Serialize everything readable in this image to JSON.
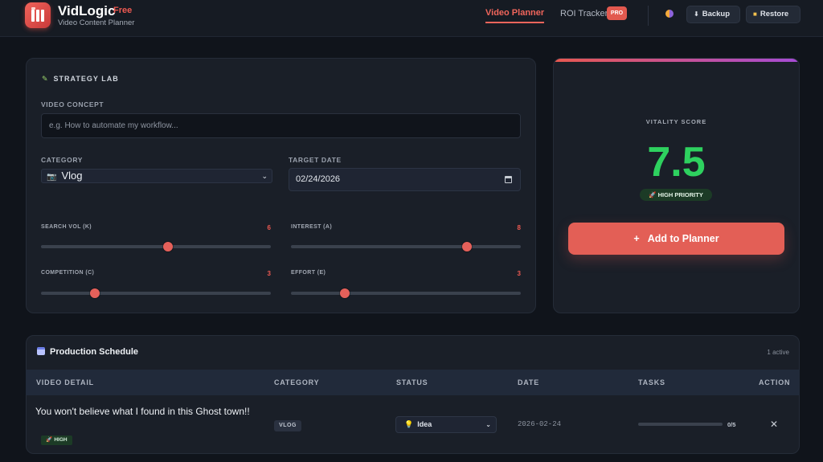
{
  "header": {
    "brand": "VidLogic",
    "tier": "Free",
    "subtitle": "Video Content Planner",
    "nav": {
      "planner": "Video Planner",
      "roi": "ROI Tracker",
      "roi_badge": "PRO"
    },
    "backup_label": "Backup",
    "restore_label": "Restore"
  },
  "lab": {
    "title": "STRATEGY LAB",
    "concept_label": "VIDEO CONCEPT",
    "concept_value": "",
    "concept_placeholder": "e.g. How to automate my workflow...",
    "category_label": "CATEGORY",
    "category_value": "Vlog",
    "date_label": "TARGET DATE",
    "date_value": "02/24/2026",
    "sliders": [
      {
        "label": "SEARCH VOL (K)",
        "value": 6,
        "max": 10
      },
      {
        "label": "INTEREST (A)",
        "value": 8,
        "max": 10
      },
      {
        "label": "COMPETITION (C)",
        "value": 3,
        "max": 10
      },
      {
        "label": "EFFORT (E)",
        "value": 3,
        "max": 10
      }
    ]
  },
  "score": {
    "label": "VITALITY SCORE",
    "value": "7.5",
    "priority": "HIGH PRIORITY",
    "add_button": "Add to Planner"
  },
  "schedule": {
    "title": "Production Schedule",
    "count": "1 active",
    "columns": [
      "VIDEO DETAIL",
      "CATEGORY",
      "STATUS",
      "DATE",
      "TASKS",
      "ACTION"
    ],
    "rows": [
      {
        "title": "You won't believe what I found in this Ghost town!!",
        "priority": "HIGH",
        "category": "VLOG",
        "status": "Idea",
        "date": "2026-02-24",
        "tasks_done": 0,
        "tasks_total": 5,
        "tasks_label": "0/5"
      }
    ]
  },
  "colors": {
    "accent": "#e35f56",
    "score_green": "#2ed15f",
    "background": "#10141b",
    "panel": "#1a1f28"
  },
  "icons": {
    "lab": "pencil-icon",
    "category": "camera-icon",
    "date": "calendar-icon",
    "backup": "download-icon",
    "restore": "folder-icon",
    "priority": "rocket-icon",
    "status": "bulb-icon",
    "action": "close-icon"
  }
}
